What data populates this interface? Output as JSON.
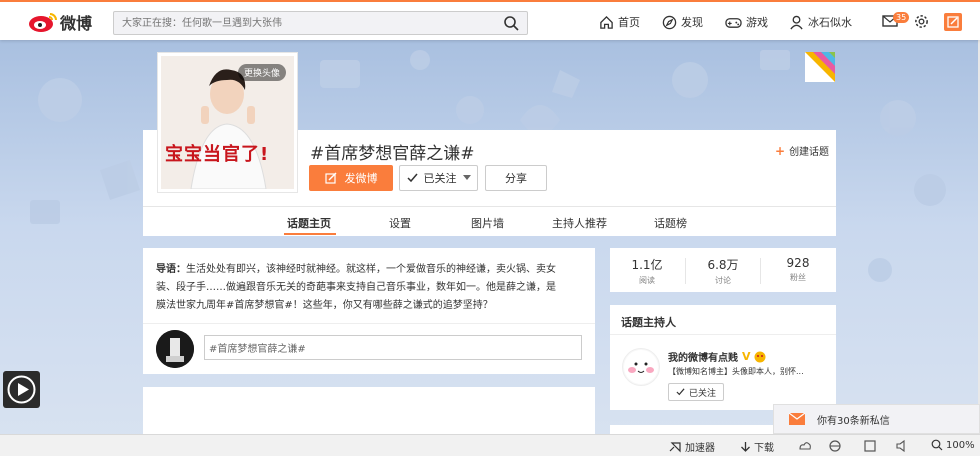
{
  "colors": {
    "accent": "#fa7d3c",
    "topic_red": "#c8161d",
    "vip_gold": "#f7b500"
  },
  "topbar": {
    "logo_text": "微博",
    "search_placeholder": "大家正在搜：任何歌一旦遇到大张伟",
    "nav": [
      {
        "label": "首页",
        "icon": "home-icon"
      },
      {
        "label": "发现",
        "icon": "compass-icon"
      },
      {
        "label": "游戏",
        "icon": "gamepad-icon"
      },
      {
        "label": "冰石似水",
        "icon": "user-icon"
      }
    ],
    "mail_count": "35"
  },
  "header": {
    "change_avatar": "更换头像",
    "avatar_caption": "宝宝当官了!",
    "title": "#首席梦想官薛之谦#",
    "create_topic": "创建话题",
    "post_button": "发微博",
    "follow_button": "已关注",
    "share_button": "分享"
  },
  "tabs": [
    {
      "label": "话题主页",
      "active": true
    },
    {
      "label": "设置",
      "active": false
    },
    {
      "label": "图片墙",
      "active": false
    },
    {
      "label": "主持人推荐",
      "active": false
    },
    {
      "label": "话题榜",
      "active": false
    }
  ],
  "intro": {
    "lead": "导语：",
    "line1": "生活处处有即兴，该神经时就神经。就这样，一个爱做音乐的神经谦，卖火锅、卖女",
    "line2": "装、段子手……做遍跟音乐无关的奇葩事来支持自己音乐事业，数年如一。他是薛之谦，是",
    "line3": "膜法世家九周年#首席梦想官#！这些年，你又有哪些薛之谦式的追梦坚持？",
    "comment_value": "#首席梦想官薛之谦#"
  },
  "stats": [
    {
      "num": "1.1亿",
      "label": "阅读"
    },
    {
      "num": "6.8万",
      "label": "讨论"
    },
    {
      "num": "928",
      "label": "粉丝"
    }
  ],
  "host": {
    "title": "话题主持人",
    "name": "我的微博有点贱",
    "desc": "【微博知名博主】头像即本人，别怀...",
    "follow_label": "已关注"
  },
  "message_popup": "你有30条新私信",
  "statusbar": {
    "accelerator": "加速器",
    "download": "下载",
    "zoom": "100%"
  }
}
